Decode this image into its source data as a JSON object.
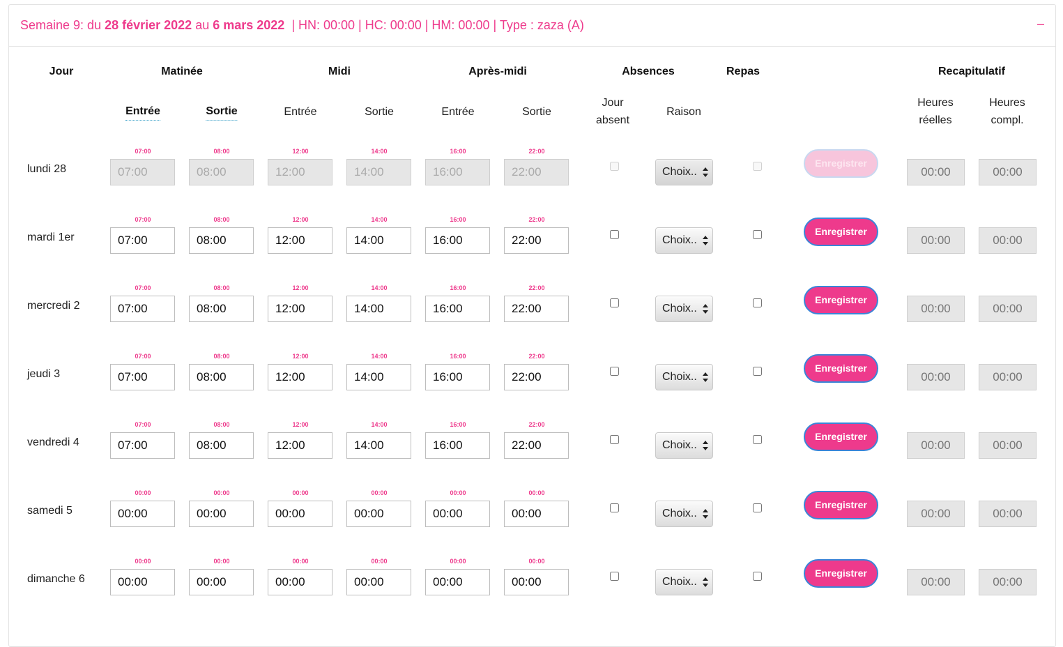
{
  "header": {
    "week_prefix": "Semaine 9: du ",
    "start_date": "28 février 2022",
    "middle": " au ",
    "end_date": "6 mars 2022",
    "suffix": "  | HN: 00:00 | HC: 00:00 | HM: 00:00 | Type : zaza (A)",
    "collapse": "–"
  },
  "columns": {
    "jour": "Jour",
    "matinee": "Matinée",
    "midi": "Midi",
    "apres_midi": "Après-midi",
    "absences": "Absences",
    "repas": "Repas",
    "recapitulatif": "Recapitulatif",
    "sub": {
      "entree": "Entrée",
      "sortie": "Sortie",
      "jour_absent_1": "Jour",
      "jour_absent_2": "absent",
      "raison": "Raison",
      "heures_reelles_1": "Heures",
      "heures_reelles_2": "réelles",
      "heures_compl_1": "Heures",
      "heures_compl_2": "compl."
    }
  },
  "select_label": "Choix..",
  "save_label": "Enregistrer",
  "rows": [
    {
      "day": "lundi 28",
      "disabled": true,
      "hints": [
        "07:00",
        "08:00",
        "12:00",
        "14:00",
        "16:00",
        "22:00"
      ],
      "times": [
        "07:00",
        "08:00",
        "12:00",
        "14:00",
        "16:00",
        "22:00"
      ],
      "recap": [
        "00:00",
        "00:00"
      ]
    },
    {
      "day": "mardi 1er",
      "disabled": false,
      "hints": [
        "07:00",
        "08:00",
        "12:00",
        "14:00",
        "16:00",
        "22:00"
      ],
      "times": [
        "07:00",
        "08:00",
        "12:00",
        "14:00",
        "16:00",
        "22:00"
      ],
      "recap": [
        "00:00",
        "00:00"
      ]
    },
    {
      "day": "mercredi 2",
      "disabled": false,
      "hints": [
        "07:00",
        "08:00",
        "12:00",
        "14:00",
        "16:00",
        "22:00"
      ],
      "times": [
        "07:00",
        "08:00",
        "12:00",
        "14:00",
        "16:00",
        "22:00"
      ],
      "recap": [
        "00:00",
        "00:00"
      ]
    },
    {
      "day": "jeudi 3",
      "disabled": false,
      "hints": [
        "07:00",
        "08:00",
        "12:00",
        "14:00",
        "16:00",
        "22:00"
      ],
      "times": [
        "07:00",
        "08:00",
        "12:00",
        "14:00",
        "16:00",
        "22:00"
      ],
      "recap": [
        "00:00",
        "00:00"
      ]
    },
    {
      "day": "vendredi 4",
      "disabled": false,
      "hints": [
        "07:00",
        "08:00",
        "12:00",
        "14:00",
        "16:00",
        "22:00"
      ],
      "times": [
        "07:00",
        "08:00",
        "12:00",
        "14:00",
        "16:00",
        "22:00"
      ],
      "recap": [
        "00:00",
        "00:00"
      ]
    },
    {
      "day": "samedi 5",
      "disabled": false,
      "hints": [
        "00:00",
        "00:00",
        "00:00",
        "00:00",
        "00:00",
        "00:00"
      ],
      "times": [
        "00:00",
        "00:00",
        "00:00",
        "00:00",
        "00:00",
        "00:00"
      ],
      "recap": [
        "00:00",
        "00:00"
      ]
    },
    {
      "day": "dimanche 6",
      "disabled": false,
      "hints": [
        "00:00",
        "00:00",
        "00:00",
        "00:00",
        "00:00",
        "00:00"
      ],
      "times": [
        "00:00",
        "00:00",
        "00:00",
        "00:00",
        "00:00",
        "00:00"
      ],
      "recap": [
        "00:00",
        "00:00"
      ]
    }
  ],
  "colors": {
    "accent": "#ee3a8c",
    "button_border": "#3a85d8",
    "readonly_bg": "#e6e6e6"
  }
}
